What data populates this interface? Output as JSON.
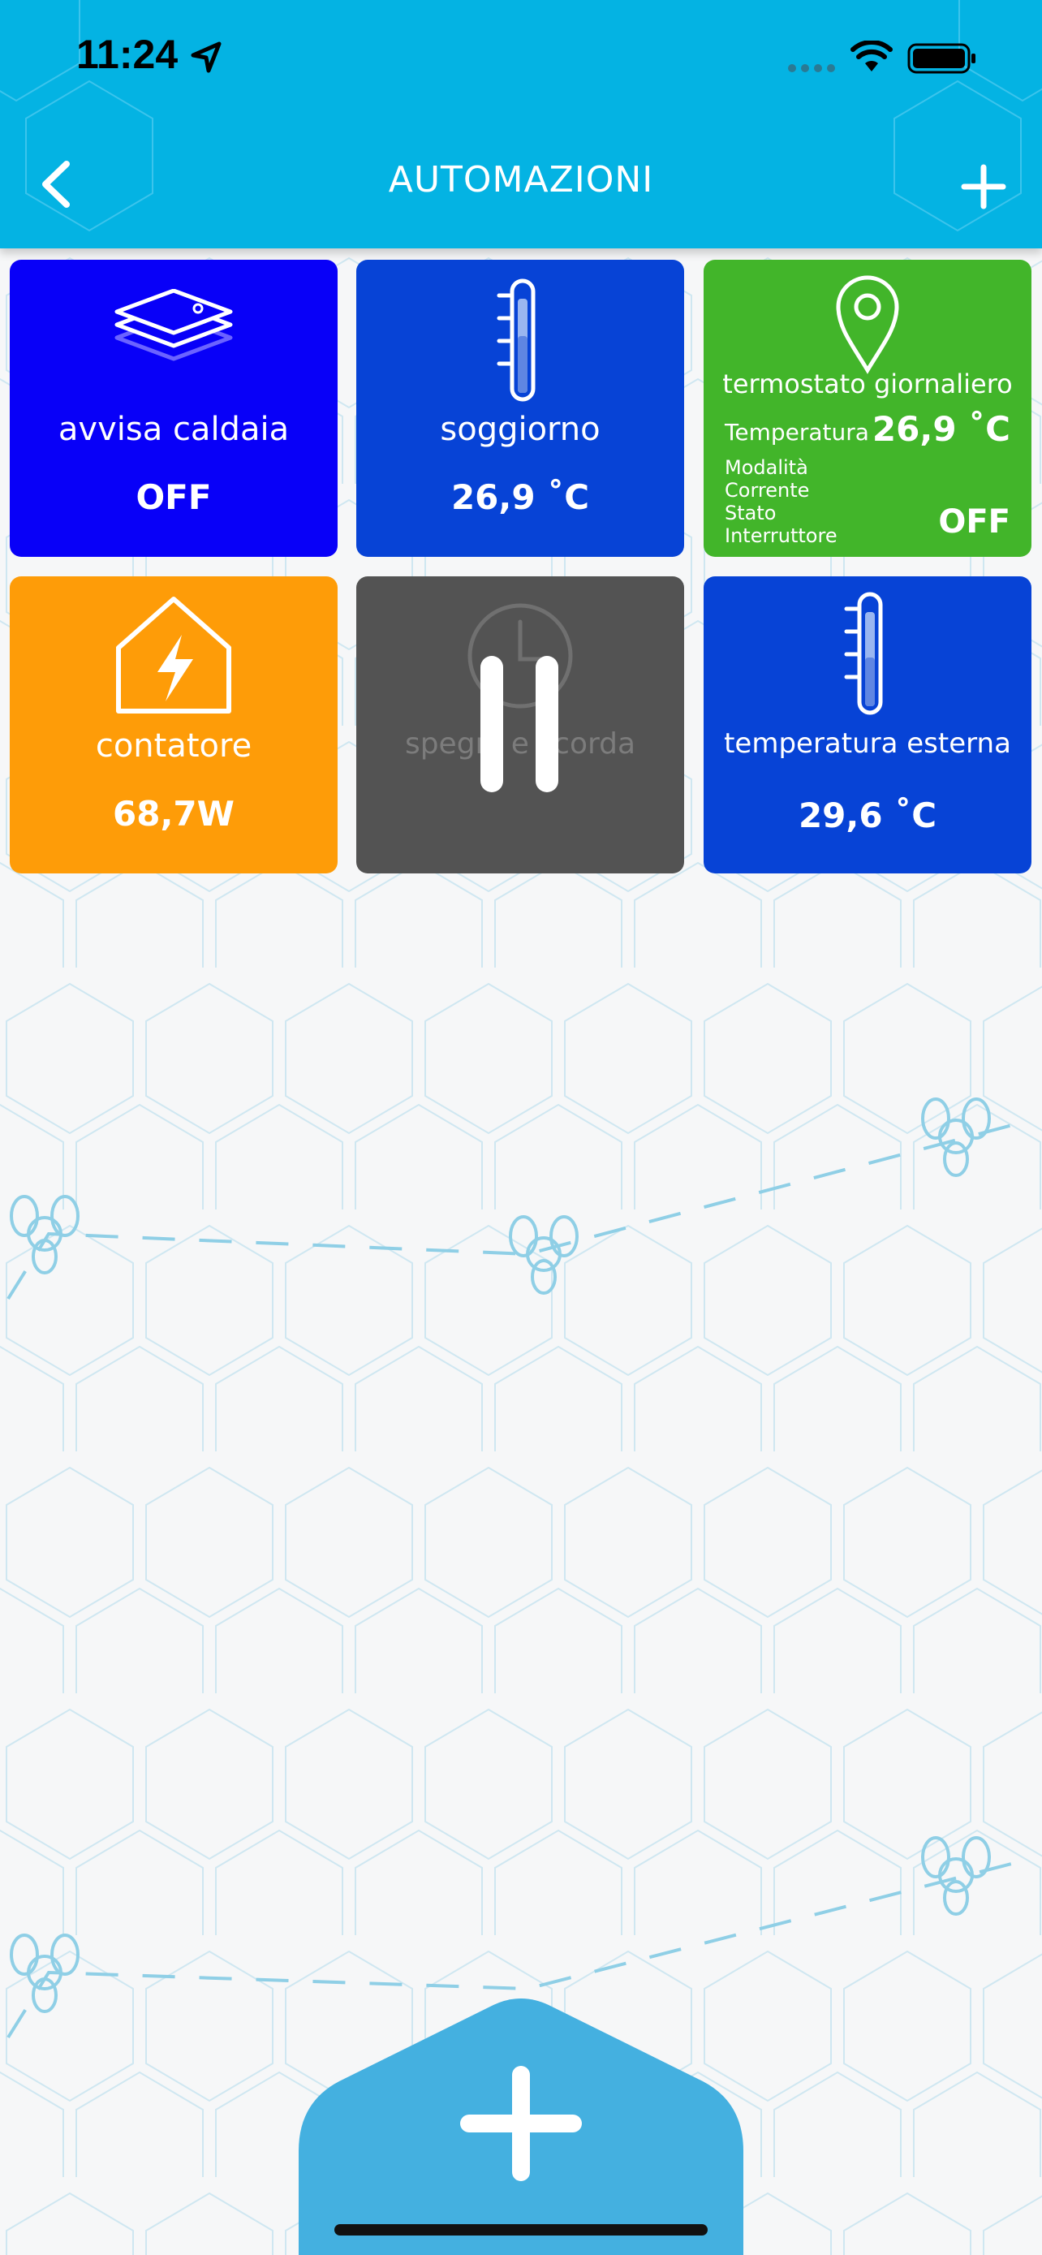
{
  "status_bar": {
    "time": "11:24"
  },
  "header": {
    "title": "AUTOMAZIONI"
  },
  "tiles": [
    {
      "name": "avvisa caldaia",
      "value": "OFF",
      "color": "#0800f8",
      "icon": "layers-icon"
    },
    {
      "name": "soggiorno",
      "value": "26,9 ˚C",
      "color": "#0743d6",
      "icon": "thermometer-icon"
    },
    {
      "name": "termostato giornaliero",
      "color": "#42b52a",
      "icon": "location-pin-icon",
      "rows": [
        "Temperatura",
        "Modalità",
        "Corrente",
        "Stato",
        "Interruttore"
      ],
      "temperature": "26,9 ˚C",
      "switch_value": "OFF"
    },
    {
      "name": "contatore",
      "value": "68,7W",
      "color": "#fe9c08",
      "icon": "house-bolt-icon"
    },
    {
      "name": "spegni e scorda",
      "color": "#535353",
      "icon": "clock-icon",
      "state": "paused"
    },
    {
      "name": "temperatura esterna",
      "value": "29,6 ˚C",
      "color": "#0743d6",
      "icon": "thermometer-icon"
    }
  ],
  "colors": {
    "header": "#04b3e3",
    "fab": "#44b0e0"
  }
}
